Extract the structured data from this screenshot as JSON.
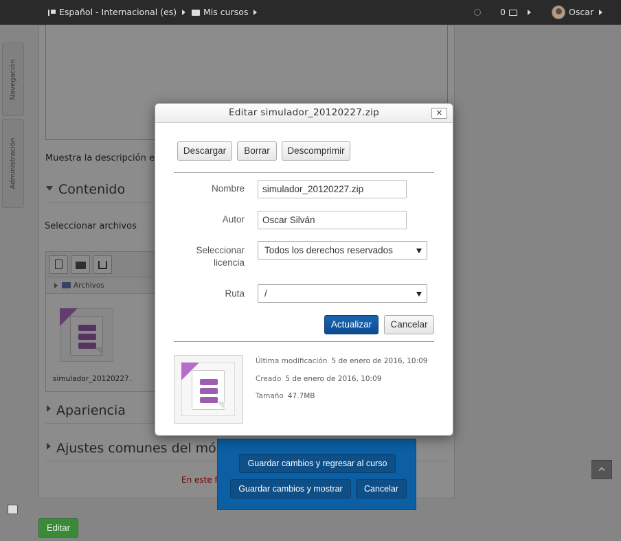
{
  "navbar": {
    "language": "Español - Internacional (es)",
    "my_courses": "Mis cursos",
    "messages_count": "0",
    "user": "Oscar"
  },
  "side": {
    "navigation": "Navegación",
    "administration": "Administración"
  },
  "page": {
    "show_description": "Muestra la descripción en la",
    "section_content": "Contenido",
    "select_files": "Seleccionar archivos",
    "folder_path": "Archivos",
    "file_name_short": "simulador_20120227.",
    "section_appearance": "Apariencia",
    "section_common": "Ajustes comunes del módulo",
    "required_note": "En este fo"
  },
  "save_panel": {
    "save_return": "Guardar cambios y regresar al curso",
    "save_show": "Guardar cambios y mostrar",
    "cancel": "Cancelar"
  },
  "edit_button": "Editar",
  "modal": {
    "title": "Editar simulador_20120227.zip",
    "close": "×",
    "download": "Descargar",
    "delete": "Borrar",
    "unzip": "Descomprimir",
    "name_label": "Nombre",
    "name_value": "simulador_20120227.zip",
    "author_label": "Autor",
    "author_value": "Oscar Silván",
    "license_label": "Seleccionar licencia",
    "license_value": "Todos los derechos reservados",
    "path_label": "Ruta",
    "path_value": "/",
    "update": "Actualizar",
    "cancel": "Cancelar",
    "modified_label": "Última modificación",
    "modified_value": "5 de enero de 2016, 10:09",
    "created_label": "Creado",
    "created_value": "5 de enero de 2016, 10:09",
    "size_label": "Tamaño",
    "size_value": "47.7MB"
  }
}
